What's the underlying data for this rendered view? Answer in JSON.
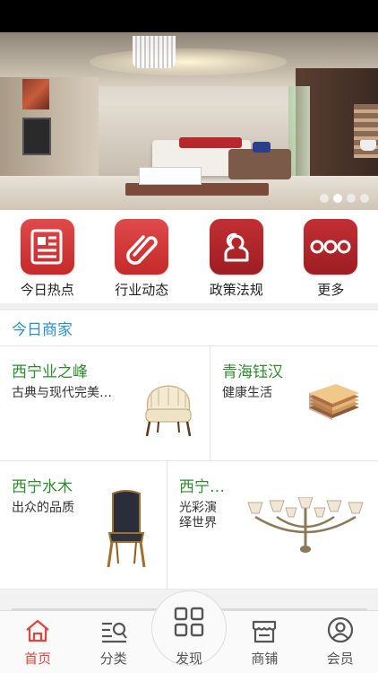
{
  "banner": {
    "total_slides": 4,
    "active_slide": 2
  },
  "quick_menu": [
    {
      "label": "今日热点",
      "icon": "newspaper-icon"
    },
    {
      "label": "行业动态",
      "icon": "paperclip-icon"
    },
    {
      "label": "政策法规",
      "icon": "people-icon"
    },
    {
      "label": "更多",
      "icon": "more-dots-icon"
    }
  ],
  "merchants": {
    "title": "今日商家",
    "items": [
      {
        "name": "西宁业之峰",
        "desc": "古典与现代完美…",
        "image": "armchair-icon"
      },
      {
        "name": "青海钰汉",
        "desc": "健康生活",
        "image": "flooring-samples-icon"
      },
      {
        "name": "西宁水木",
        "desc": "出众的品质",
        "image": "dining-chair-icon"
      },
      {
        "name": "西宁…",
        "desc_line1": "光彩演",
        "desc_line2": "绎世界",
        "image": "chandelier-icon"
      }
    ]
  },
  "tab_bar": {
    "tabs": [
      {
        "label": "首页",
        "icon": "home-icon",
        "active": true
      },
      {
        "label": "分类",
        "icon": "category-search-icon"
      },
      {
        "label": "发现",
        "icon": "grid-icon"
      },
      {
        "label": "商铺",
        "icon": "shop-icon"
      },
      {
        "label": "会员",
        "icon": "user-icon"
      }
    ],
    "active_color": "#e0443f"
  },
  "colors": {
    "accent_red": "#d93a3a",
    "section_title": "#2c8fc9",
    "shop_name": "#2e8b2e"
  }
}
